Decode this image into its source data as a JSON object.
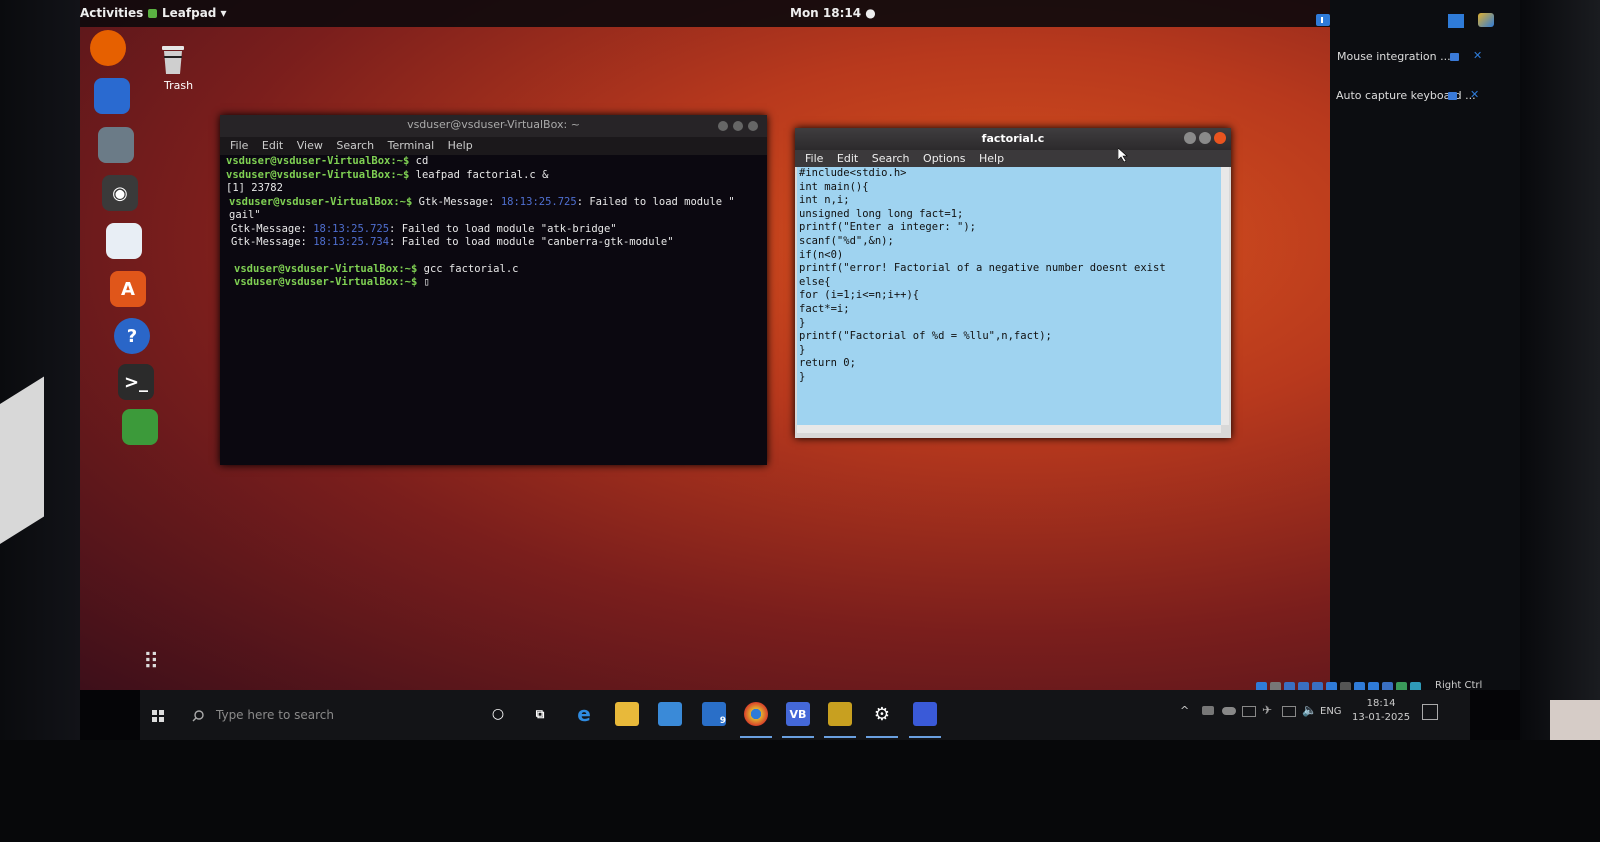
{
  "topbar": {
    "activities": "Activities",
    "app_menu": "Leafpad ▾",
    "clock": "Mon 18:14 ●"
  },
  "desktop": {
    "trash_label": "Trash"
  },
  "dock": [
    {
      "name": "firefox-icon",
      "glyph": "",
      "color": "#e66000"
    },
    {
      "name": "thunderbird-icon",
      "glyph": "",
      "color": "#2a6ad0"
    },
    {
      "name": "files-icon",
      "glyph": "",
      "color": "#6b7b87"
    },
    {
      "name": "rhythmbox-icon",
      "glyph": "◉",
      "color": "#3a3a3a"
    },
    {
      "name": "writer-icon",
      "glyph": "",
      "color": "#e8eef5"
    },
    {
      "name": "software-icon",
      "glyph": "A",
      "color": "#e0561a"
    },
    {
      "name": "help-icon",
      "glyph": "?",
      "color": "#2a66c8"
    },
    {
      "name": "terminal-icon",
      "glyph": ">_",
      "color": "#2b2b2b"
    },
    {
      "name": "leafpad-icon",
      "glyph": "",
      "color": "#3c9a3a"
    }
  ],
  "terminal": {
    "title": "vsduser@vsduser-VirtualBox: ~",
    "menu": [
      "File",
      "Edit",
      "View",
      "Search",
      "Terminal",
      "Help"
    ],
    "prompt": "vsduser@vsduser-VirtualBox:~$",
    "cmd1": " cd",
    "cmd2": " leafpad factorial.c &",
    "job": "[1] 23782",
    "cmd3_label": " Gtk-Message: ",
    "ts1": "18:13:25.725",
    "msg1": ": Failed to load module \"",
    "msg1b": "gail\"",
    "gtk": "Gtk-Message: ",
    "ts2": "18:13:25.725",
    "msg2": ": Failed to load module \"atk-bridge\"",
    "ts3": "18:13:25.734",
    "msg3": ": Failed to load module \"canberra-gtk-module\"",
    "cmd4": " gcc factorial.c",
    "cursor": " ▯"
  },
  "leafpad": {
    "title": "factorial.c",
    "menu": [
      "File",
      "Edit",
      "Search",
      "Options",
      "Help"
    ],
    "lines": [
      "#include<stdio.h>",
      "int main(){",
      "int n,i;",
      "unsigned long long fact=1;",
      "printf(\"Enter a integer: \");",
      "scanf(\"%d\",&n);",
      "if(n<0)",
      "printf(\"error! Factorial of a negative number doesnt exist",
      "else{",
      "for (i=1;i<=n;i++){",
      "fact*=i;",
      "}",
      "printf(\"Factorial of %d = %llu\",n,fact);",
      "}",
      "return 0;",
      "}"
    ]
  },
  "vbox_notifications": {
    "mouse": "Mouse integration ...",
    "keyboard": "Auto capture keyboard ...",
    "host_key": "Right Ctrl"
  },
  "taskbar": {
    "search_placeholder": "Type here to search",
    "lang": "ENG",
    "time": "18:14",
    "date": "13-01-2025",
    "mail_badge": "9"
  }
}
